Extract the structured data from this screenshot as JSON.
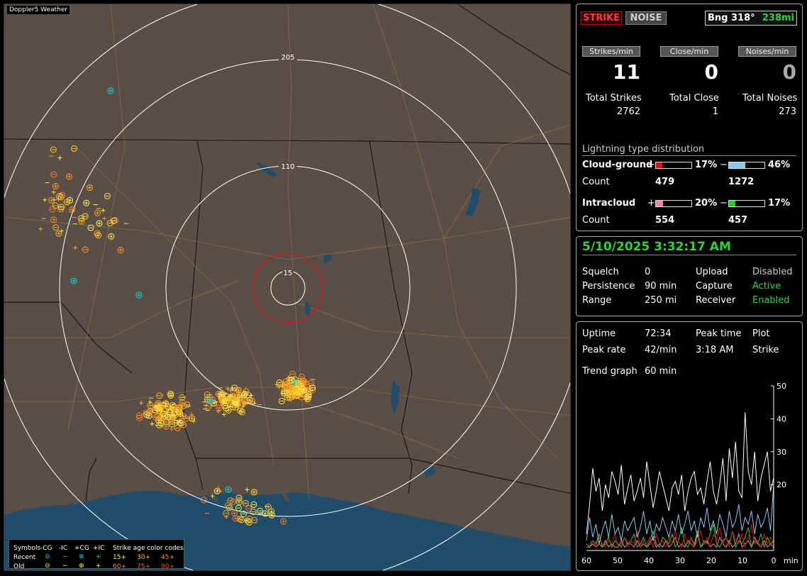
{
  "app": {
    "title": "Doppler5 Weather"
  },
  "map": {
    "range_labels": [
      "205",
      "110",
      "15"
    ],
    "legend": {
      "symbols_label": "Symbols",
      "cols": [
        "-CG",
        "-IC",
        "+CG",
        "+IC"
      ],
      "rows": [
        "Recent",
        "Old"
      ],
      "age_title": "Strike age color codes",
      "age_recent": [
        "15+",
        "30+",
        "45+"
      ],
      "age_old": [
        "60+",
        "75+",
        "90+"
      ]
    }
  },
  "status": {
    "strike_button": "STRIKE",
    "noise_button": "NOISE",
    "bearing": "Bng 318°",
    "distance": "238mi"
  },
  "rates": {
    "strikes_label": "Strikes/min",
    "close_label": "Close/min",
    "noises_label": "Noises/min",
    "strikes_value": "11",
    "close_value": "0",
    "noises_value": "0"
  },
  "totals": {
    "strikes_label": "Total Strikes",
    "close_label": "Total Close",
    "noises_label": "Total Noises",
    "strikes_value": "2762",
    "close_value": "1",
    "noises_value": "273"
  },
  "distribution": {
    "title": "Lightning type distribution",
    "cg_label": "Cloud-ground",
    "ic_label": "Intracloud",
    "count_label": "Count",
    "plus": "+",
    "minus": "−",
    "cg_pos_pct": "17%",
    "cg_neg_pct": "46%",
    "ic_pos_pct": "20%",
    "ic_neg_pct": "17%",
    "cg_pos_count": "479",
    "cg_neg_count": "1272",
    "ic_pos_count": "554",
    "ic_neg_count": "457",
    "cg_pos_frac": 0.17,
    "cg_neg_frac": 0.46,
    "ic_pos_frac": 0.2,
    "ic_neg_frac": 0.17,
    "colors": {
      "cg_pos": "#e01010",
      "cg_neg": "#8cc8f0",
      "ic_pos": "#f080b0",
      "ic_neg": "#20d020"
    }
  },
  "receiver": {
    "datetime": "5/10/2025 3:32:17 AM",
    "squelch_label": "Squelch",
    "squelch_value": "0",
    "persistence_label": "Persistence",
    "persistence_value": "90 min",
    "range_label": "Range",
    "range_value": "250 mi",
    "upload_label": "Upload",
    "upload_value": "Disabled",
    "capture_label": "Capture",
    "capture_value": "Active",
    "receiver_label": "Receiver",
    "receiver_value": "Enabled"
  },
  "stats": {
    "uptime_label": "Uptime",
    "uptime_value": "72:34",
    "peak_time_label": "Peak time",
    "peak_time_value": "3:18 AM",
    "plot_label": "Plot",
    "plot_value": "Strike",
    "peak_rate_label": "Peak rate",
    "peak_rate_value": "42/min",
    "trend_label": "Trend graph",
    "trend_value": "60 min"
  },
  "chart_data": {
    "type": "line",
    "x_ticks": [
      "60",
      "50",
      "40",
      "30",
      "20",
      "10",
      "0"
    ],
    "x_unit": "min",
    "y_ticks": [
      "50",
      "40",
      "30",
      "20"
    ],
    "ylim": [
      0,
      50
    ],
    "xlim": [
      60,
      0
    ],
    "series": [
      {
        "color": "#ffffff",
        "values": [
          5,
          14,
          25,
          18,
          22,
          12,
          20,
          16,
          24,
          21,
          17,
          26,
          14,
          19,
          23,
          15,
          18,
          22,
          16,
          27,
          20,
          13,
          18,
          24,
          20,
          16,
          12,
          19,
          21,
          17,
          23,
          12,
          18,
          22,
          24,
          17,
          19,
          14,
          21,
          27,
          18,
          14,
          20,
          28,
          15,
          31,
          22,
          33,
          18,
          16,
          42,
          24,
          20,
          30,
          15,
          22,
          26,
          30,
          18,
          22
        ]
      },
      {
        "color": "#8cc8f0",
        "values": [
          3,
          10,
          4,
          8,
          2,
          6,
          9,
          4,
          11,
          5,
          7,
          3,
          9,
          6,
          8,
          10,
          4,
          7,
          12,
          5,
          9,
          3,
          8,
          6,
          10,
          7,
          4,
          9,
          6,
          11,
          5,
          8,
          12,
          6,
          9,
          4,
          10,
          7,
          13,
          6,
          9,
          5,
          11,
          8,
          4,
          12,
          7,
          9,
          14,
          6,
          10,
          8,
          12,
          5,
          11,
          7,
          9,
          13,
          6,
          20
        ]
      },
      {
        "color": "#e01010",
        "values": [
          1,
          2,
          3,
          1,
          4,
          2,
          1,
          3,
          2,
          5,
          1,
          2,
          4,
          1,
          3,
          2,
          6,
          1,
          3,
          2,
          4,
          1,
          5,
          2,
          3,
          1,
          4,
          2,
          6,
          3,
          1,
          5,
          2,
          4,
          1,
          3,
          6,
          2,
          4,
          1,
          5,
          3,
          7,
          2,
          4,
          1,
          6,
          3,
          2,
          5,
          1,
          4,
          8,
          2,
          3,
          1,
          5,
          2,
          4,
          2
        ]
      },
      {
        "color": "#20d020",
        "values": [
          2,
          1,
          3,
          2,
          5,
          1,
          2,
          4,
          1,
          3,
          2,
          1,
          4,
          2,
          3,
          5,
          1,
          2,
          4,
          1,
          3,
          6,
          2,
          1,
          4,
          3,
          2,
          5,
          1,
          3,
          7,
          2,
          1,
          4,
          2,
          6,
          1,
          3,
          2,
          5,
          8,
          2,
          1,
          3,
          4,
          2,
          6,
          1,
          3,
          2,
          4,
          7,
          1,
          3,
          2,
          5,
          1,
          4,
          2,
          3
        ]
      },
      {
        "color": "#f080b0",
        "values": [
          1,
          1,
          2,
          1,
          2,
          1,
          3,
          1,
          2,
          1,
          1,
          3,
          1,
          2,
          2,
          1,
          3,
          1,
          2,
          1,
          2,
          4,
          1,
          2,
          1,
          3,
          1,
          2,
          4,
          1,
          2,
          1,
          3,
          2,
          1,
          5,
          1,
          2,
          3,
          1,
          2,
          1,
          4,
          2,
          1,
          3,
          1,
          2,
          5,
          1,
          2,
          3,
          1,
          4,
          2,
          1,
          3,
          1,
          2,
          1
        ]
      }
    ]
  }
}
